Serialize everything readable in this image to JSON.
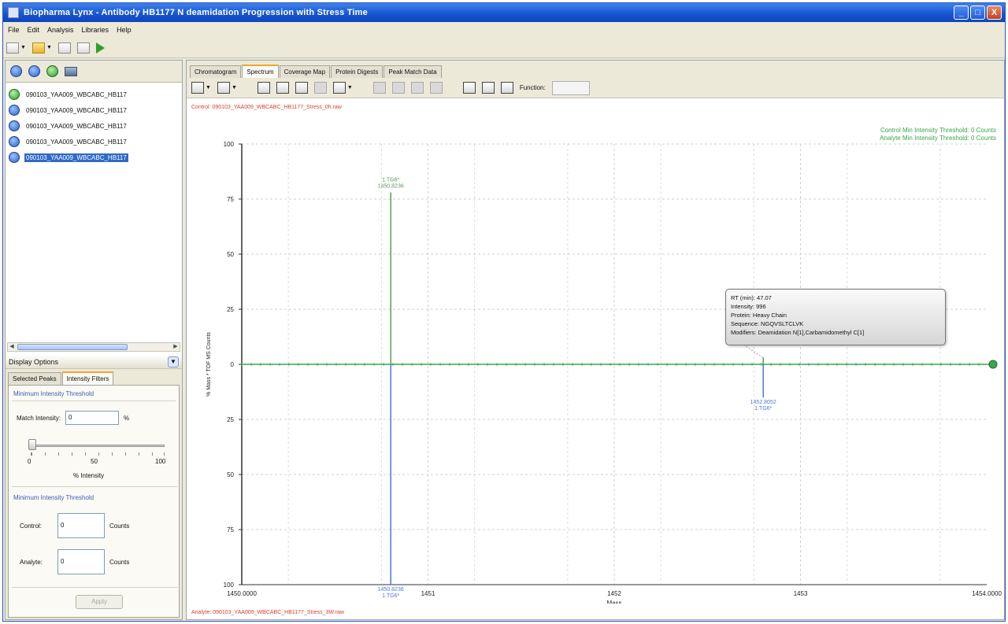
{
  "window": {
    "title": "Biopharma Lynx - Antibody HB1177 N deamidation Progression with Stress Time",
    "controls": [
      "_",
      "□",
      "X"
    ]
  },
  "menubar": [
    "File",
    "Edit",
    "Analysis",
    "Libraries",
    "Help"
  ],
  "files": [
    {
      "name": "090103_YAA009_WBCABC_HB117",
      "selected": false
    },
    {
      "name": "090103_YAA009_WBCABC_HB117",
      "selected": false
    },
    {
      "name": "090103_YAA009_WBCABC_HB117",
      "selected": false
    },
    {
      "name": "090103_YAA009_WBCABC_HB117",
      "selected": false
    },
    {
      "name": "090103_YAA009_WBCABC_HB117",
      "selected": true
    }
  ],
  "display_options": {
    "title": "Display Options",
    "tabs": [
      "Selected Peaks",
      "Intensity Filters"
    ],
    "active_tab": "Intensity Filters",
    "group1_title": "Minimum Intensity Threshold",
    "match_intensity_label": "Match Intensity:",
    "match_intensity_value": "0",
    "percent_unit": "%",
    "slider_min": "0",
    "slider_mid": "50",
    "slider_max": "100",
    "slider_caption": "% Intensity",
    "slider_value": 0,
    "group2_title": "Minimum Intensity Threshold",
    "control_label": "Control:",
    "control_value": "0",
    "analyte_label": "Analyte:",
    "analyte_value": "0",
    "counts_unit": "Counts",
    "apply_label": "Apply"
  },
  "main_tabs": [
    "Chromatogram",
    "Spectrum",
    "Coverage Map",
    "Protein Digests",
    "Peak Match Data"
  ],
  "active_main_tab": "Spectrum",
  "spectrum_toolbar": {
    "function_label": "Function:"
  },
  "spectrum": {
    "control_file": "Control: 090103_YAA009_WBCABC_HB1177_Stress_0h.raw",
    "analyte_file": "Analyte: 090103_YAA009_WBCABC_HB1177_Stress_3W.raw",
    "threshold_control": "Control Min Intensity Threshold: 0 Counts",
    "threshold_analyte": "Analyte Min Intensity Threshold: 0 Counts",
    "tooltip": {
      "rt": "RT (min): 47.07",
      "intensity": "Intensity: 996",
      "protein": "Protein: Heavy Chain",
      "sequence": "Sequence: NGQVSLTCLVK",
      "modifiers": "Modifiers: Deamidation N[1],Carbamidomethyl C[1]"
    }
  },
  "chart_data": {
    "type": "bar",
    "xlabel": "Mass",
    "ylabel": "% Mass * TOF MS Counts",
    "x_ticks": [
      "1450.0000",
      "1451",
      "1452",
      "1453",
      "1454.0000"
    ],
    "xlim": [
      1450.0,
      1454.0
    ],
    "y_ticks": [
      "100",
      "75",
      "50",
      "25",
      "0",
      "25",
      "50",
      "75",
      "100"
    ],
    "ylim": [
      -100,
      100
    ],
    "grid": true,
    "peaks": [
      {
        "x": 1450.8,
        "y": 78,
        "label": "1450.8236",
        "sublabel": "1.TG6*",
        "series": "control",
        "color": "#5a9a55"
      },
      {
        "x": 1450.8,
        "y": -100,
        "label": "1450.8236",
        "sublabel": "1.TG6*",
        "series": "analyte",
        "color": "#4a78d8"
      },
      {
        "x": 1452.8,
        "y": 3,
        "label": "",
        "sublabel": "",
        "series": "control",
        "color": "#5a9a55"
      },
      {
        "x": 1452.8,
        "y": -15,
        "label": "1452.8052",
        "sublabel": "1.TG6*",
        "series": "analyte",
        "color": "#4a78d8"
      }
    ]
  },
  "colors": {
    "control": "#5a9a55",
    "analyte": "#4a78d8",
    "axis_zero": "#3aa64a",
    "filenames": "#d9412d"
  }
}
